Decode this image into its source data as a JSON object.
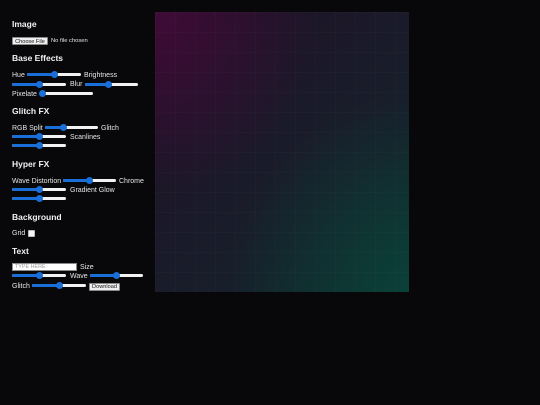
{
  "sections": {
    "image": "Image",
    "base_effects": "Base Effects",
    "glitch_fx": "Glitch FX",
    "hyper_fx": "Hyper FX",
    "background": "Background",
    "text": "Text"
  },
  "image": {
    "choose_file_label": "Choose File",
    "file_status": "No file chosen"
  },
  "base_effects": {
    "hue": {
      "label": "Hue",
      "value": 0.5
    },
    "brightness": {
      "label": "Brightness",
      "value": 0.5
    },
    "blur": {
      "label": "Blur",
      "value": 0.45
    },
    "pixelate": {
      "label": "Pixelate",
      "value": 0.02
    }
  },
  "glitch_fx": {
    "rgb_split": {
      "label": "RGB Split",
      "value": 0.35
    },
    "glitch": {
      "label": "Glitch",
      "value": 0.5
    },
    "scanlines": {
      "label": "Scanlines",
      "value": 0.5
    }
  },
  "hyper_fx": {
    "wave_distortion": {
      "label": "Wave Distortion",
      "value": 0.5
    },
    "chrome": {
      "label": "Chrome",
      "value": 0.5
    },
    "gradient_glow": {
      "label": "Gradient Glow",
      "value": 0.5
    }
  },
  "background": {
    "grid": {
      "label": "Grid",
      "checked": false
    }
  },
  "text": {
    "input_placeholder": "TYPE HERE",
    "input_value": "",
    "size": {
      "label": "Size",
      "value": 0.5
    },
    "wave": {
      "label": "Wave",
      "value": 0.5
    },
    "glitch": {
      "label": "Glitch",
      "value": 0.5
    },
    "download_label": "Download"
  },
  "colors": {
    "page_background": "#08080a",
    "slider_accent": "#1a6ed8",
    "canvas_tint_top_left": "#46103c",
    "canvas_tint_bottom_right": "#0e2b2a"
  }
}
